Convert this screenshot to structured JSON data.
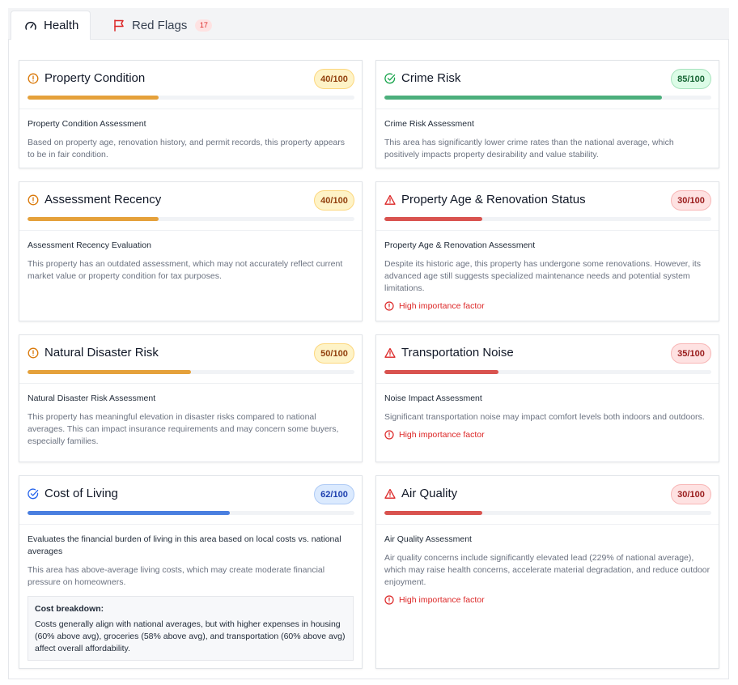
{
  "tabs": {
    "health_label": "Health",
    "red_flags_label": "Red Flags",
    "red_flags_count": "17"
  },
  "colors": {
    "amber": "#e5a13b",
    "green": "#4caf7c",
    "red": "#d9534f",
    "blue": "#4a7fe0"
  },
  "cards": [
    {
      "title": "Property Condition",
      "score_label": "40/100",
      "score": 40,
      "status": "amber",
      "icon": "alert-circle-icon",
      "subtitle": "Property Condition Assessment",
      "description": "Based on property age, renovation history, and permit records, this property appears to be in fair condition."
    },
    {
      "title": "Crime Risk",
      "score_label": "85/100",
      "score": 85,
      "status": "green",
      "icon": "check-circle-icon",
      "subtitle": "Crime Risk Assessment",
      "description": "This area has significantly lower crime rates than the national average, which positively impacts property desirability and value stability."
    },
    {
      "title": "Assessment Recency",
      "score_label": "40/100",
      "score": 40,
      "status": "amber",
      "icon": "alert-circle-icon",
      "subtitle": "Assessment Recency Evaluation",
      "description": "This property has an outdated assessment, which may not accurately reflect current market value or property condition for tax purposes."
    },
    {
      "title": "Property Age & Renovation Status",
      "score_label": "30/100",
      "score": 30,
      "status": "red",
      "icon": "warning-triangle-icon",
      "subtitle": "Property Age & Renovation Assessment",
      "description": "Despite its historic age, this property has undergone some renovations. However, its advanced age still suggests specialized maintenance needs and potential system limitations.",
      "importance": "High importance factor"
    },
    {
      "title": "Natural Disaster Risk",
      "score_label": "50/100",
      "score": 50,
      "status": "amber",
      "icon": "alert-circle-icon",
      "subtitle": "Natural Disaster Risk Assessment",
      "description": "This property has meaningful elevation in disaster risks compared to national averages. This can impact insurance requirements and may concern some buyers, especially families."
    },
    {
      "title": "Transportation Noise",
      "score_label": "35/100",
      "score": 35,
      "status": "red",
      "icon": "warning-triangle-icon",
      "subtitle": "Noise Impact Assessment",
      "description": "Significant transportation noise may impact comfort levels both indoors and outdoors.",
      "importance": "High importance factor"
    },
    {
      "title": "Cost of Living",
      "score_label": "62/100",
      "score": 62,
      "status": "blue",
      "icon": "check-circle-icon",
      "subtitle": "Evaluates the financial burden of living in this area based on local costs vs. national averages",
      "description": "This area has above-average living costs, which may create moderate financial pressure on homeowners.",
      "breakdown_title": "Cost breakdown:",
      "breakdown_text": "Costs generally align with national averages, but with higher expenses in housing (60% above avg), groceries (58% above avg), and transportation (60% above avg) affect overall affordability."
    },
    {
      "title": "Air Quality",
      "score_label": "30/100",
      "score": 30,
      "status": "red",
      "icon": "warning-triangle-icon",
      "subtitle": "Air Quality Assessment",
      "description": "Air quality concerns include significantly elevated lead (229% of national average), which may raise health concerns, accelerate material degradation, and reduce outdoor enjoyment.",
      "importance": "High importance factor"
    }
  ]
}
